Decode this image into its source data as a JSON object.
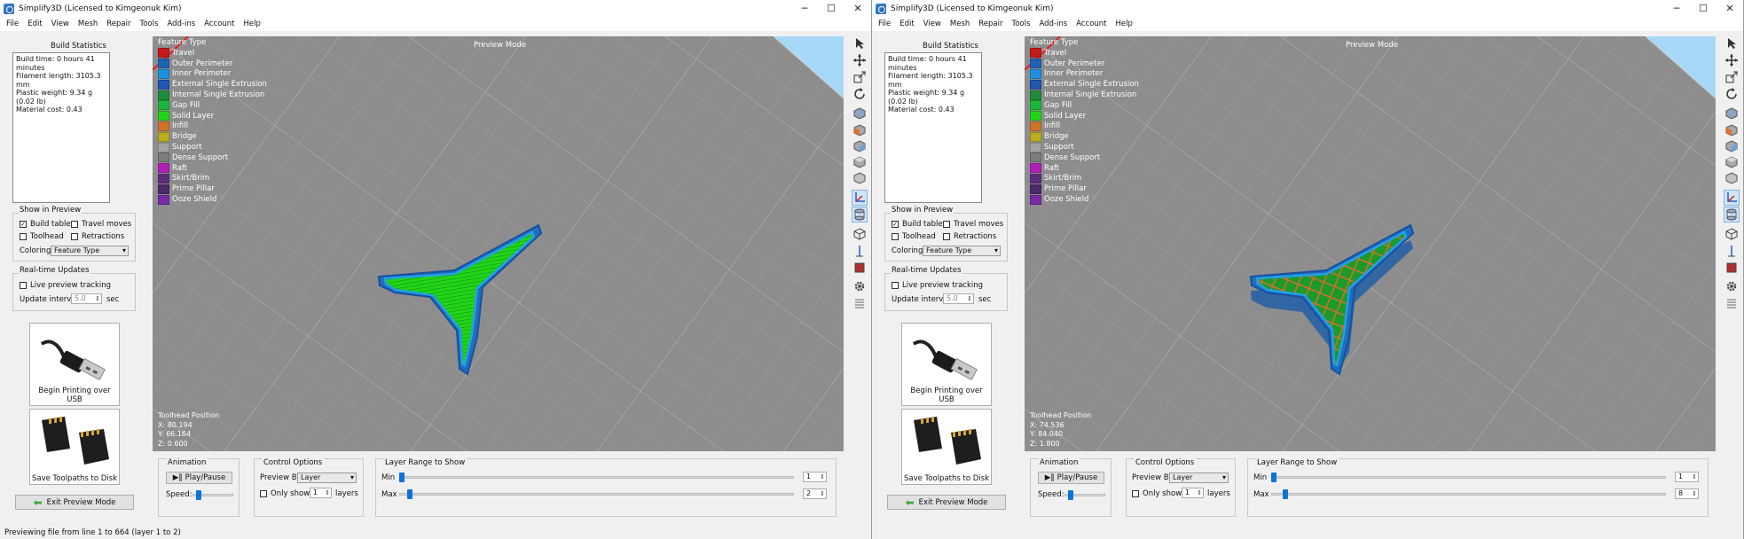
{
  "windows": [
    {
      "title": "Simplify3D (Licensed to Kimgeonuk Kim)",
      "menu": [
        "File",
        "Edit",
        "View",
        "Mesh",
        "Repair",
        "Tools",
        "Add-ins",
        "Account",
        "Help"
      ],
      "build_stats": {
        "title": "Build Statistics",
        "lines": [
          "Build time: 0 hours 41 minutes",
          "Filament length: 3105.3 mm",
          "Plastic weight: 9.34 g (0.02 lb)",
          "Material cost: 0.43"
        ]
      },
      "show_in_preview": {
        "title": "Show in Preview",
        "build_table": "Build table",
        "travel_moves": "Travel moves",
        "toolhead": "Toolhead",
        "retractions": "Retractions",
        "build_table_checked": true,
        "coloring_label": "Coloring",
        "coloring_value": "Feature Type"
      },
      "realtime": {
        "title": "Real-time Updates",
        "live_tracking": "Live preview tracking",
        "update_interval_label": "Update interval",
        "update_interval_value": "5.0",
        "unit": "sec"
      },
      "usb_button": "Begin Printing over USB",
      "save_button": "Save Toolpaths to Disk",
      "exit_button": "Exit Preview Mode",
      "preview_mode": "Preview Mode",
      "legend": {
        "title": "Feature Type",
        "items": [
          {
            "label": "Travel",
            "color": "#c41a1a"
          },
          {
            "label": "Outer Perimeter",
            "color": "#1f63b4"
          },
          {
            "label": "Inner Perimeter",
            "color": "#1f8fe0"
          },
          {
            "label": "External Single Extrusion",
            "color": "#2457b0"
          },
          {
            "label": "Internal Single Extrusion",
            "color": "#1f8c3a"
          },
          {
            "label": "Gap Fill",
            "color": "#19b83a"
          },
          {
            "label": "Solid Layer",
            "color": "#22d418"
          },
          {
            "label": "Infill",
            "color": "#d0742a"
          },
          {
            "label": "Bridge",
            "color": "#b8ae1e"
          },
          {
            "label": "Support",
            "color": "#a4a4a4"
          },
          {
            "label": "Dense Support",
            "color": "#7c7c7c"
          },
          {
            "label": "Raft",
            "color": "#b21cb8"
          },
          {
            "label": "Skirt/Brim",
            "color": "#5c2d7a"
          },
          {
            "label": "Prime Pillar",
            "color": "#4a2a6a"
          },
          {
            "label": "Ooze Shield",
            "color": "#7a2aa8"
          }
        ]
      },
      "toolhead": {
        "title": "Toolhead Position",
        "x": "X: 80.194",
        "y": "Y: 66.164",
        "z": "Z: 0.600"
      },
      "animation": {
        "title": "Animation",
        "play_pause": "Play/Pause",
        "speed_label": "Speed:",
        "speed": 0.1
      },
      "control_options": {
        "title": "Control Options",
        "preview_by_label": "Preview By",
        "preview_by_value": "Layer",
        "only_show_label": "Only show",
        "only_show_value": "1",
        "layers_label": "layers"
      },
      "layer_range": {
        "title": "Layer Range to Show",
        "min_label": "Min",
        "max_label": "Max",
        "min_value": "1",
        "max_value": "2",
        "min_fraction": 0.0,
        "max_fraction": 0.02
      },
      "status": "Previewing file from line 1 to 664 (layer 1 to 2)"
    },
    {
      "title": "Simplify3D (Licensed to Kimgeonuk Kim)",
      "menu": [
        "File",
        "Edit",
        "View",
        "Mesh",
        "Repair",
        "Tools",
        "Add-ins",
        "Account",
        "Help"
      ],
      "build_stats": {
        "title": "Build Statistics",
        "lines": [
          "Build time: 0 hours 41 minutes",
          "Filament length: 3105.3 mm",
          "Plastic weight: 9.34 g (0.02 lb)",
          "Material cost: 0.43"
        ]
      },
      "show_in_preview": {
        "title": "Show in Preview",
        "build_table": "Build table",
        "travel_moves": "Travel moves",
        "toolhead": "Toolhead",
        "retractions": "Retractions",
        "build_table_checked": true,
        "coloring_label": "Coloring",
        "coloring_value": "Feature Type"
      },
      "realtime": {
        "title": "Real-time Updates",
        "live_tracking": "Live preview tracking",
        "update_interval_label": "Update interval",
        "update_interval_value": "5.0",
        "unit": "sec"
      },
      "usb_button": "Begin Printing over USB",
      "save_button": "Save Toolpaths to Disk",
      "exit_button": "Exit Preview Mode",
      "preview_mode": "Preview Mode",
      "legend": {
        "title": "Feature Type",
        "items": [
          {
            "label": "Travel",
            "color": "#c41a1a"
          },
          {
            "label": "Outer Perimeter",
            "color": "#1f63b4"
          },
          {
            "label": "Inner Perimeter",
            "color": "#1f8fe0"
          },
          {
            "label": "External Single Extrusion",
            "color": "#2457b0"
          },
          {
            "label": "Internal Single Extrusion",
            "color": "#1f8c3a"
          },
          {
            "label": "Gap Fill",
            "color": "#19b83a"
          },
          {
            "label": "Solid Layer",
            "color": "#22d418"
          },
          {
            "label": "Infill",
            "color": "#d0742a"
          },
          {
            "label": "Bridge",
            "color": "#b8ae1e"
          },
          {
            "label": "Support",
            "color": "#a4a4a4"
          },
          {
            "label": "Dense Support",
            "color": "#7c7c7c"
          },
          {
            "label": "Raft",
            "color": "#b21cb8"
          },
          {
            "label": "Skirt/Brim",
            "color": "#5c2d7a"
          },
          {
            "label": "Prime Pillar",
            "color": "#4a2a6a"
          },
          {
            "label": "Ooze Shield",
            "color": "#7a2aa8"
          }
        ]
      },
      "toolhead": {
        "title": "Toolhead Position",
        "x": "X: 74.536",
        "y": "Y: 84.040",
        "z": "Z: 1.800"
      },
      "animation": {
        "title": "Animation",
        "play_pause": "Play/Pause",
        "speed_label": "Speed:",
        "speed": 0.1
      },
      "control_options": {
        "title": "Control Options",
        "preview_by_label": "Preview By",
        "preview_by_value": "Layer",
        "only_show_label": "Only show",
        "only_show_value": "1",
        "layers_label": "layers"
      },
      "layer_range": {
        "title": "Layer Range to Show",
        "min_label": "Min",
        "max_label": "Max",
        "min_value": "1",
        "max_value": "8",
        "min_fraction": 0.0,
        "max_fraction": 0.03
      },
      "status": ""
    }
  ]
}
